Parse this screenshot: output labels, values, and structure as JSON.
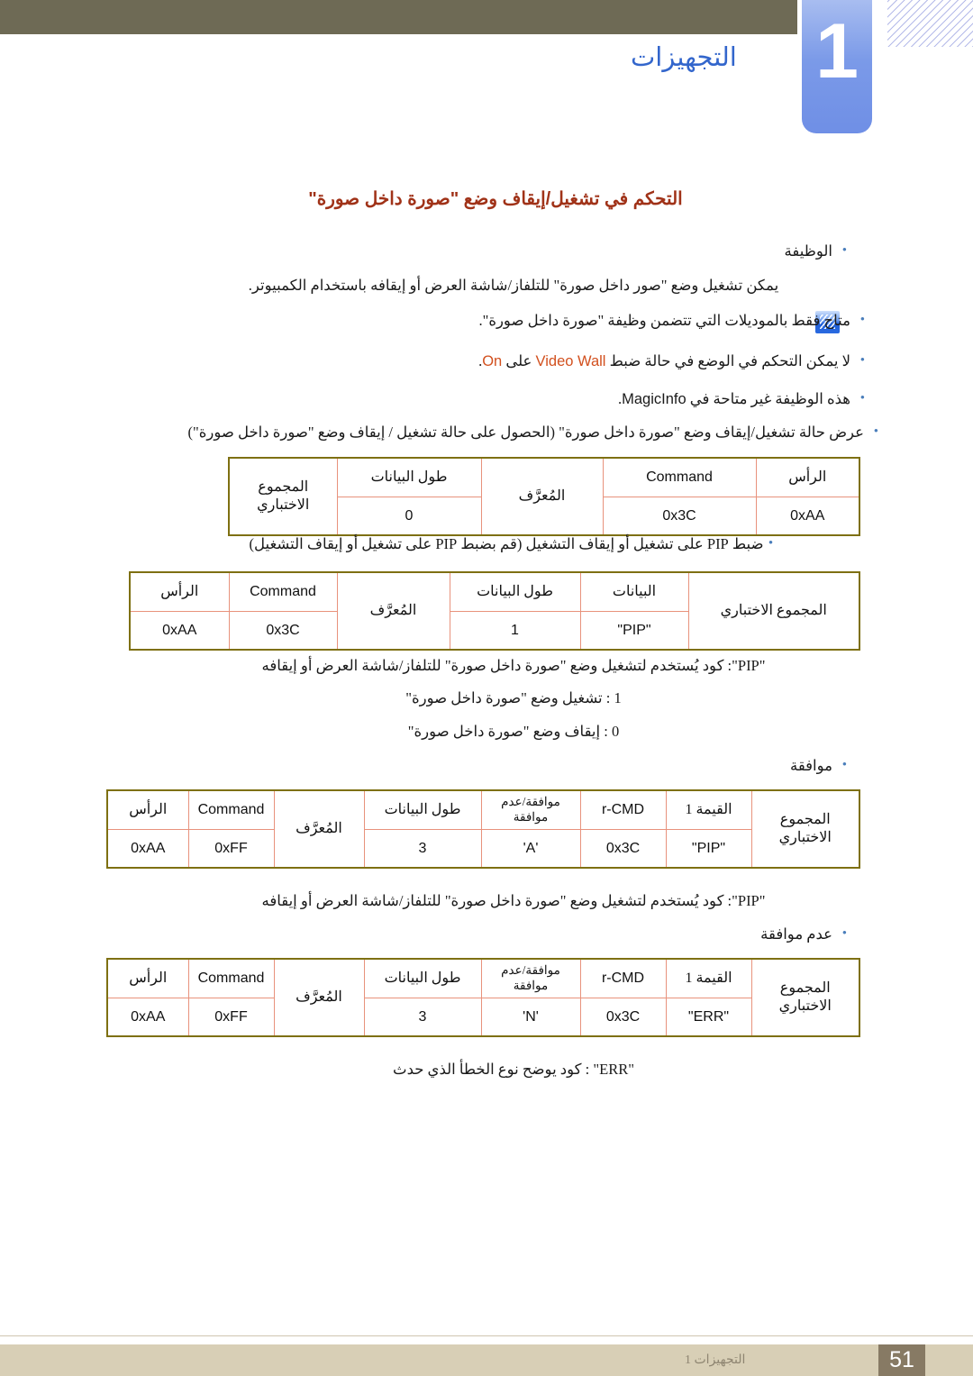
{
  "header": {
    "chapter_number": "1",
    "chapter_title": "التجهيزات",
    "band_color": "#6e6a55",
    "tab_color": "#7b9ae8"
  },
  "page_title": "التحكم في تشغيل/إيقاف وضع \"صورة داخل صورة\"",
  "sections": {
    "function_bullet": "الوظيفة",
    "function_desc": "يمكن تشغيل وضع \"صور داخل صورة\" للتلفاز/شاشة العرض أو إيقافه باستخدام الكمبيوتر.",
    "note_items": [
      "متاح فقط بالموديلات التي تتضمن وظيفة \"صورة داخل صورة\".",
      "لا يمكن التحكم في الوضع في حالة ضبط Video Wall على On.",
      "هذه الوظيفة غير متاحة في MagicInfo."
    ],
    "note_2_prefix": "لا يمكن التحكم في الوضع في حالة ضبط",
    "note_2_hl1": "Video Wall",
    "note_2_mid": "على",
    "note_2_hl2": "On",
    "note_2_suffix": ".",
    "note_3_prefix": "هذه الوظيفة غير متاحة في",
    "note_3_term": "MagicInfo",
    "note_3_suffix": ".",
    "view_status_bullet": "عرض حالة تشغيل/إيقاف وضع \"صورة داخل صورة\" (الحصول على حالة تشغيل / إيقاف وضع \"صورة داخل صورة\")",
    "set_pip_bullet": "ضبط PIP على تشغيل أو إيقاف التشغيل (قم بضبط PIP على تشغيل أو إيقاف التشغيل)",
    "pip_code_desc": "\"PIP\": كود يُستخدم لتشغيل وضع \"صورة داخل صورة\" للتلفاز/شاشة العرض أو إيقافه",
    "pip_on_desc": "1 : تشغيل وضع \"صورة داخل صورة\"",
    "pip_off_desc": "0 : إيقاف وضع \"صورة داخل صورة\"",
    "ack_bullet": "موافقة",
    "pip_code_desc_2": "\"PIP\": كود يُستخدم لتشغيل وضع \"صورة داخل صورة\" للتلفاز/شاشة العرض أو إيقافه",
    "nak_bullet": "عدم موافقة",
    "err_desc": "\"ERR\" : كود يوضح نوع الخطأ الذي حدث"
  },
  "tables": {
    "get_request": {
      "headers": [
        "الرأس",
        "Command",
        "المُعرَّف",
        "طول البيانات",
        "المجموع الاختباري"
      ],
      "values": [
        "0xAA",
        "0x3C",
        "",
        "0",
        ""
      ],
      "checksum_label_line1": "المجموع",
      "checksum_label_line2": "الاختباري"
    },
    "set_request": {
      "headers": [
        "الرأس",
        "Command",
        "المُعرَّف",
        "طول البيانات",
        "البيانات",
        "المجموع الاختباري"
      ],
      "values": [
        "0xAA",
        "0x3C",
        "",
        "1",
        "\"PIP\"",
        ""
      ],
      "checksum_label": "المجموع الاختباري"
    },
    "ack": {
      "headers": [
        "الرأس",
        "Command",
        "المُعرَّف",
        "طول البيانات",
        "موافقة/عدم موافقة",
        "r-CMD",
        "القيمة 1",
        "المجموع الاختباري"
      ],
      "ack_header_line1": "موافقة/عدم",
      "ack_header_line2": "موافقة",
      "values": [
        "0xAA",
        "0xFF",
        "",
        "3",
        "'A'",
        "0x3C",
        "\"PIP\"",
        ""
      ],
      "checksum_label_line1": "المجموع",
      "checksum_label_line2": "الاختباري"
    },
    "nak": {
      "headers": [
        "الرأس",
        "Command",
        "المُعرَّف",
        "طول البيانات",
        "موافقة/عدم موافقة",
        "r-CMD",
        "القيمة 1",
        "المجموع الاختباري"
      ],
      "ack_header_line1": "موافقة/عدم",
      "ack_header_line2": "موافقة",
      "values": [
        "0xAA",
        "0xFF",
        "",
        "3",
        "'N'",
        "0x3C",
        "\"ERR\"",
        ""
      ],
      "checksum_label_line1": "المجموع",
      "checksum_label_line2": "الاختباري"
    }
  },
  "footer": {
    "text": "التجهيزات 1",
    "page_number": "51"
  },
  "colors": {
    "title": "#a03218",
    "accent_highlight": "#d2501e",
    "table_outer_border": "#7e7012",
    "table_inner_border": "#e8927c",
    "bullet": "#4a7ebb",
    "chapter_blue": "#3366cc",
    "footer_bar": "#d8cfb6",
    "footer_box": "#877a64"
  }
}
